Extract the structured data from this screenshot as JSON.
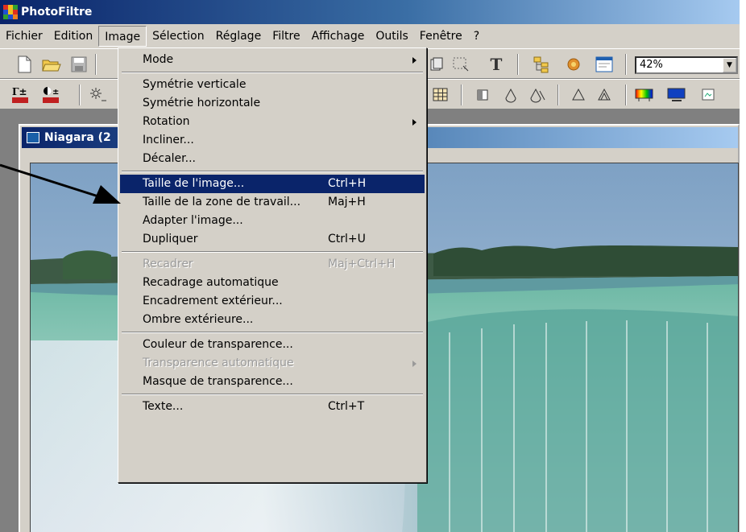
{
  "window": {
    "title": "PhotoFiltre",
    "app_icon": "photofiltre-logo-icon"
  },
  "menubar": {
    "items": [
      "Fichier",
      "Edition",
      "Image",
      "Sélection",
      "Réglage",
      "Filtre",
      "Affichage",
      "Outils",
      "Fenêtre",
      "?"
    ],
    "open_item": "Image"
  },
  "toolbar": {
    "zoom_value": "42%",
    "text_tool_label": "T",
    "icons": [
      "new-file-icon",
      "open-folder-icon",
      "save-disk-icon",
      "selection-rect-icon",
      "text-tool-icon",
      "explorer-icon",
      "plugin-icon",
      "window-icon"
    ]
  },
  "toolbar2": {
    "icons": [
      "gamma-auto-icon",
      "contrast-auto-icon",
      "brightness-icon",
      "grid-icon",
      "crop-icon",
      "blur-icon",
      "more-blur-icon",
      "sharpen-icon",
      "more-sharpen-icon",
      "gradient-icon",
      "monitor-icon"
    ]
  },
  "document": {
    "title": "Niagara (2"
  },
  "menu": {
    "items": [
      {
        "label": "Mode",
        "shortcut": "",
        "submenu": true,
        "disabled": false,
        "selected": false
      },
      {
        "separator": true
      },
      {
        "label": "Symétrie verticale",
        "shortcut": "",
        "submenu": false,
        "disabled": false,
        "selected": false
      },
      {
        "label": "Symétrie horizontale",
        "shortcut": "",
        "submenu": false,
        "disabled": false,
        "selected": false
      },
      {
        "label": "Rotation",
        "shortcut": "",
        "submenu": true,
        "disabled": false,
        "selected": false
      },
      {
        "label": "Incliner...",
        "shortcut": "",
        "submenu": false,
        "disabled": false,
        "selected": false
      },
      {
        "label": "Décaler...",
        "shortcut": "",
        "submenu": false,
        "disabled": false,
        "selected": false
      },
      {
        "separator": true
      },
      {
        "label": "Taille de l'image...",
        "shortcut": "Ctrl+H",
        "submenu": false,
        "disabled": false,
        "selected": true
      },
      {
        "label": "Taille de la zone de travail...",
        "shortcut": "Maj+H",
        "submenu": false,
        "disabled": false,
        "selected": false
      },
      {
        "label": "Adapter l'image...",
        "shortcut": "",
        "submenu": false,
        "disabled": false,
        "selected": false
      },
      {
        "label": "Dupliquer",
        "shortcut": "Ctrl+U",
        "submenu": false,
        "disabled": false,
        "selected": false
      },
      {
        "separator": true
      },
      {
        "label": "Recadrer",
        "shortcut": "Maj+Ctrl+H",
        "submenu": false,
        "disabled": true,
        "selected": false
      },
      {
        "label": "Recadrage automatique",
        "shortcut": "",
        "submenu": false,
        "disabled": false,
        "selected": false
      },
      {
        "label": "Encadrement extérieur...",
        "shortcut": "",
        "submenu": false,
        "disabled": false,
        "selected": false
      },
      {
        "label": "Ombre extérieure...",
        "shortcut": "",
        "submenu": false,
        "disabled": false,
        "selected": false
      },
      {
        "separator": true
      },
      {
        "label": "Couleur de transparence...",
        "shortcut": "",
        "submenu": false,
        "disabled": false,
        "selected": false
      },
      {
        "label": "Transparence automatique",
        "shortcut": "",
        "submenu": true,
        "disabled": true,
        "selected": false
      },
      {
        "label": "Masque de transparence...",
        "shortcut": "",
        "submenu": false,
        "disabled": false,
        "selected": false
      },
      {
        "separator": true
      },
      {
        "label": "Texte...",
        "shortcut": "Ctrl+T",
        "submenu": false,
        "disabled": false,
        "selected": false
      }
    ]
  },
  "colors": {
    "title_gradient_start": "#0a246a",
    "title_gradient_end": "#a6caf0",
    "menu_highlight": "#0a246a",
    "chrome": "#d4d0c8"
  }
}
